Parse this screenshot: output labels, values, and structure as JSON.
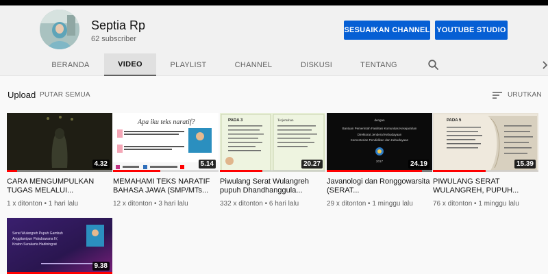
{
  "channel": {
    "name": "Septia Rp",
    "subscribers": "62 subscriber",
    "customize_label": "SESUAIKAN CHANNEL",
    "studio_label": "YOUTUBE STUDIO"
  },
  "tabs": [
    {
      "label": "BERANDA"
    },
    {
      "label": "VIDEO"
    },
    {
      "label": "PLAYLIST"
    },
    {
      "label": "CHANNEL"
    },
    {
      "label": "DISKUSI"
    },
    {
      "label": "TENTANG"
    }
  ],
  "active_tab": "VIDEO",
  "section": {
    "title": "Upload",
    "play_all": "PUTAR SEMUA",
    "sort_label": "URUTKAN"
  },
  "videos": [
    {
      "title": "CARA MENGUMPULKAN TUGAS MELALUI...",
      "meta": "1 x ditonton • 1 hari lalu",
      "duration": "4.32",
      "watched": 0.1
    },
    {
      "title": "MEMAHAMI TEKS NARATIF BAHASA JAWA (SMP/MTs...",
      "meta": "12 x ditonton • 3 hari lalu",
      "duration": "5.14",
      "watched": 0.45
    },
    {
      "title": "Piwulang Serat Wulangreh pupuh Dhandhanggula...",
      "meta": "332 x ditonton • 6 hari lalu",
      "duration": "20.27",
      "watched": 0.4
    },
    {
      "title": "Javanologi dan Ronggowarsita (SERAT...",
      "meta": "29 x ditonton • 1 minggu lalu",
      "duration": "24.19",
      "watched": 0.9
    },
    {
      "title": "PIWULANG SERAT WULANGREH, PUPUH...",
      "meta": "76 x ditonton • 1 minggu lalu",
      "duration": "15.39",
      "watched": 0.5
    },
    {
      "title": "",
      "meta": "",
      "duration": "9.38",
      "watched": 1.0
    }
  ],
  "thumb_text": {
    "v2_heading": "Apa iku teks naratif?",
    "v3_heading": "PADA 3",
    "v3_subheading": "Terjemahan",
    "v4_line1": "dengan",
    "v4_line2": "Bantuan Pemerintah Fasilitasi Komunitas Kesejarahan",
    "v4_line3": "Direktorat Jenderal Kebudayaan",
    "v4_line4": "Kementerian Pendidikan dan Kebudayaan",
    "v4_year": "2017",
    "v5_heading": "PADA 5",
    "v6_line1": "Serat Wulangreh Pupuh Gambuh",
    "v6_line2": "Anggitanipun Pakubuwana IV,",
    "v6_line3": "Kraton Surakarta Hadiningrat"
  },
  "colors": {
    "accent_blue": "#065fd4",
    "progress_red": "#ff0000"
  }
}
